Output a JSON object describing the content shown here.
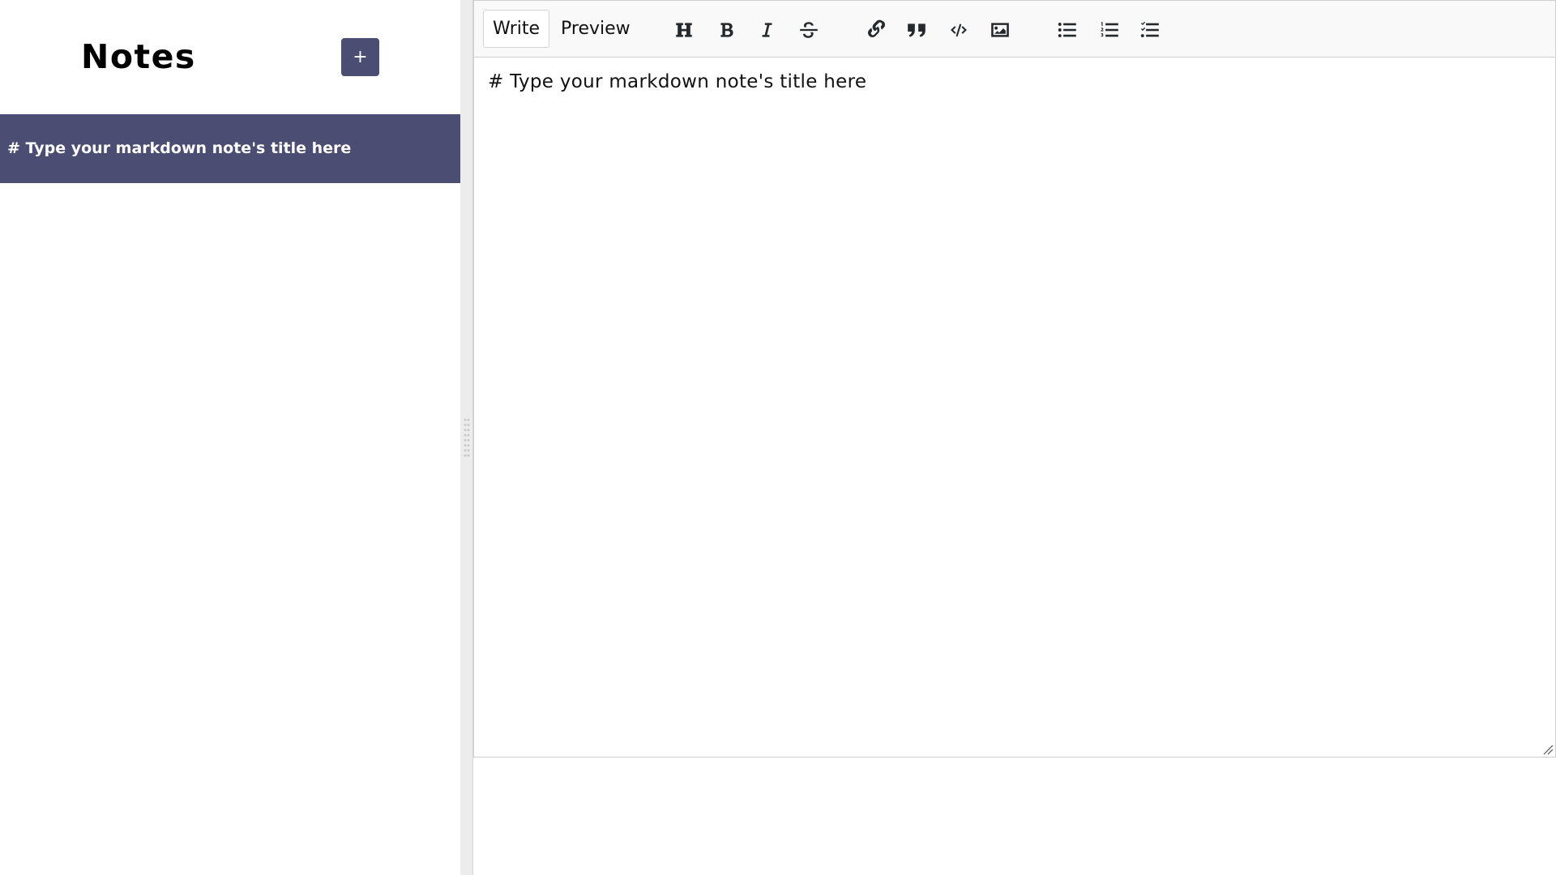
{
  "sidebar": {
    "title": "Notes",
    "add_button_label": "+",
    "notes": [
      {
        "title": "# Type your markdown note's title here",
        "selected": true
      }
    ]
  },
  "editor": {
    "tabs": [
      {
        "label": "Write",
        "active": true
      },
      {
        "label": "Preview",
        "active": false
      }
    ],
    "toolbar_icons": [
      "header-icon",
      "bold-icon",
      "italic-icon",
      "strikethrough-icon",
      "link-icon",
      "quote-icon",
      "code-icon",
      "image-icon",
      "unordered-list-icon",
      "ordered-list-icon",
      "checked-list-icon"
    ],
    "content": "# Type your markdown note's title here"
  },
  "colors": {
    "accent": "#4b4d73",
    "toolbar_bg": "#f9f9f9",
    "divider_bg": "#ececec"
  }
}
